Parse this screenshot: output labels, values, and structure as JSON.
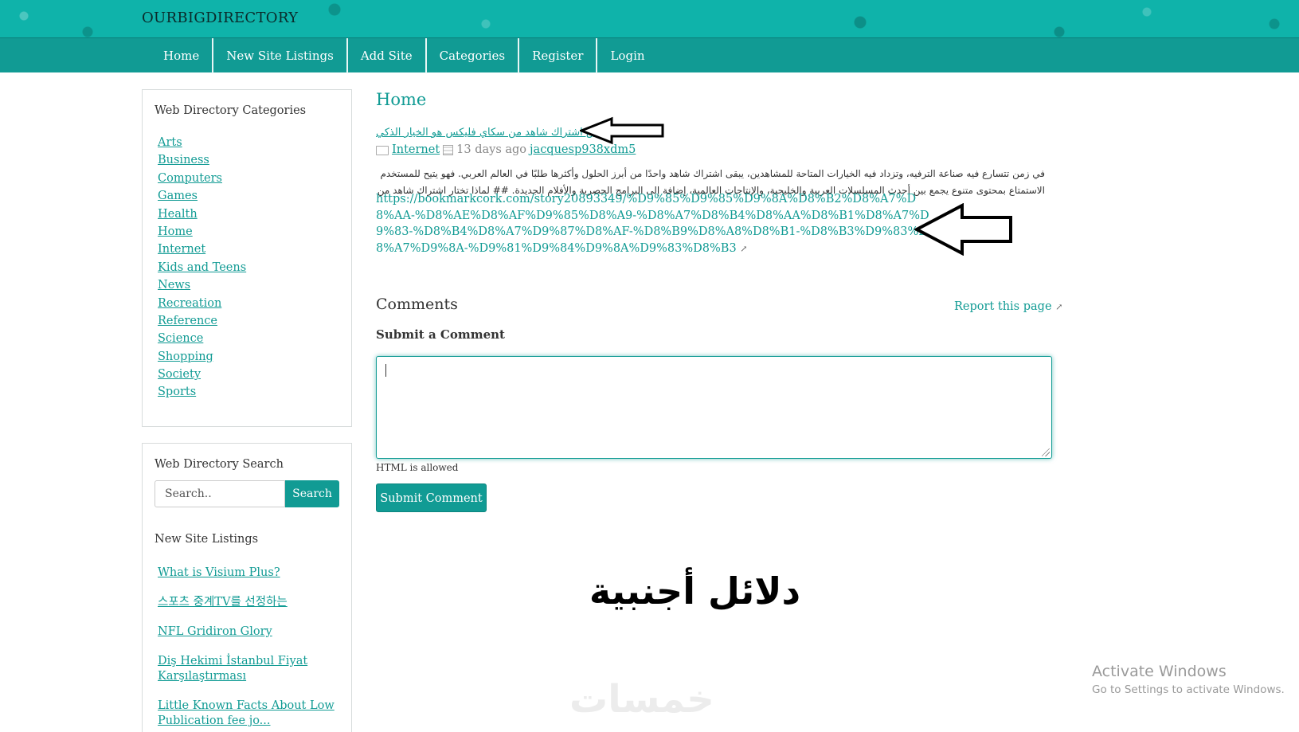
{
  "site": {
    "title": "OURBIGDIRECTORY"
  },
  "nav": [
    {
      "label": "Home"
    },
    {
      "label": "New Site Listings"
    },
    {
      "label": "Add Site"
    },
    {
      "label": "Categories"
    },
    {
      "label": "Register"
    },
    {
      "label": "Login"
    }
  ],
  "sidebar": {
    "categories_title": "Web Directory Categories",
    "categories": [
      "Arts",
      "Business",
      "Computers",
      "Games",
      "Health",
      "Home",
      "Internet",
      "Kids and Teens",
      "News",
      "Recreation",
      "Reference",
      "Science",
      "Shopping",
      "Society",
      "Sports"
    ],
    "search_title": "Web Directory Search",
    "search_placeholder": "Search..",
    "search_button": "Search",
    "listings_title": "New Site Listings",
    "listings": [
      "What is Visium Plus?",
      "스포츠 중계TV를 선정하는",
      "NFL Gridiron Glory",
      "Diş Hekimi İstanbul Fiyat Karşılaştırması",
      "Little Known Facts About Low Publication fee jo..."
    ]
  },
  "main": {
    "heading": "Home",
    "entry_title": "ليش اشتراك شاهد من سكاي فليكس هو الخيار الذكي",
    "category": "Internet",
    "age": "13 days ago",
    "author": "jacquesp938xdm5",
    "description": "في زمن تتسارع فيه صناعة الترفيه، وتزداد فيه الخيارات المتاحة للمشاهدين، يبقى اشتراك شاهد واحدًا من أبرز الحلول وأكثرها طلبًا في العالم العربي. فهو يتيح للمستخدم الاستمتاع بمحتوى متنوع يجمع بين أحدث المسلسلات العربية والخليجية، والإنتاجات العالمية، إضافة إلى البرامج الحصرية والأفلام الجديدة. ## لماذا تختار اشتراك شاهد من",
    "link_text": "https://bookmarkcork.com/story20893349/%D9%85%D9%85%D9%8A%D8%B2%D8%A7%D8%AA-%D8%AE%D8%AF%D9%85%D8%A9-%D8%A7%D8%B4%D8%AA%D8%B1%D8%A7%D9%83-%D8%B4%D8%A7%D9%87%D8%AF-%D8%B9%D8%A8%D8%B1-%D8%B3%D9%83%D8%A7%D9%8A-%D9%81%D9%84%D9%8A%D9%83%D8%B3",
    "comments_heading": "Comments",
    "report_link": "Report this page",
    "submit_heading": "Submit a Comment",
    "html_note": "HTML is allowed",
    "submit_button": "Submit Comment"
  },
  "overlay": {
    "big_arabic": "دلائل أجنبية",
    "watermark": "خمسات"
  },
  "os": {
    "activate_title": "Activate Windows",
    "activate_sub": "Go to Settings to activate Windows."
  },
  "colors": {
    "accent": "#119b94",
    "header": "#0fb3aa"
  }
}
